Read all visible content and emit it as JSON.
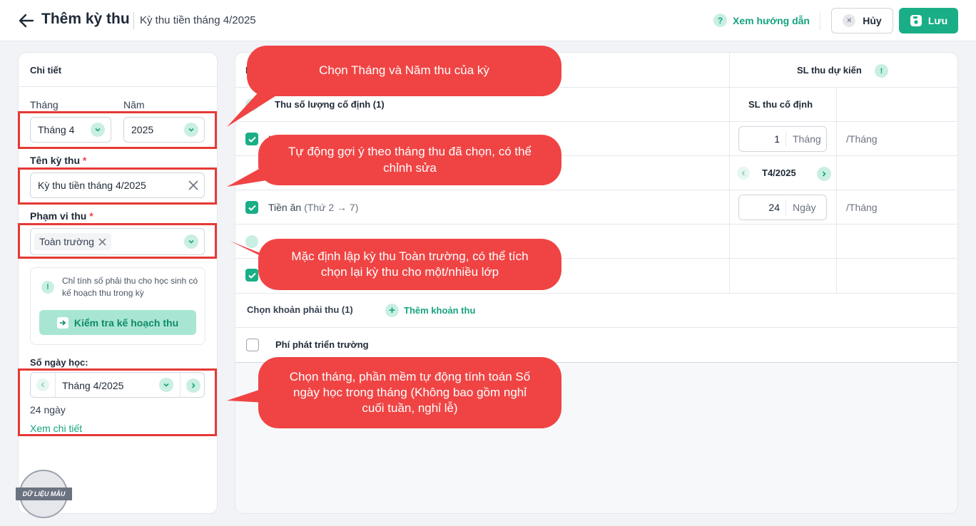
{
  "header": {
    "title": "Thêm kỳ thu",
    "subtitle": "Kỳ thu tiền tháng 4/2025",
    "guide": "Xem hướng dẫn",
    "cancel": "Hủy",
    "save": "Lưu"
  },
  "left": {
    "section": "Chi tiết",
    "month_label": "Tháng",
    "month_value": "Tháng 4",
    "year_label": "Năm",
    "year_value": "2025",
    "name_label": "Tên kỳ thu",
    "req": "*",
    "name_value": "Kỳ thu tiền tháng 4/2025",
    "scope_label": "Phạm vi thu",
    "scope_tag": "Toàn trường",
    "note": "Chỉ tính số phải thu cho học sinh có kế hoạch thu trong kỳ",
    "check_button": "Kiểm tra kế hoạch thu",
    "days_label": "Số ngày học:",
    "days_month": "Tháng 4/2025",
    "days_value": "24 ngày",
    "detail_link": "Xem chi tiết"
  },
  "right": {
    "col_head_left": "K",
    "col_head_right": "SL thu dự kiến",
    "group_fixed": "Thu số lượng cố định (1)",
    "col_fixed": "SL thu cố định",
    "row1_left": "H",
    "row1_value": "1",
    "row1_unit": "Tháng",
    "row1_per": "/Tháng",
    "month_nav": "T4/2025",
    "row2_name": "Tiền ăn",
    "row2_detail": "(Thứ 2 → 7)",
    "row2_value": "24",
    "row2_unit": "Ngày",
    "row2_per": "/Tháng",
    "optional_label": "Chọn khoản phải thu (1)",
    "add_label": "Thêm khoản thu",
    "fee": "Phí phát triển trường"
  },
  "callouts": {
    "c1": "Chọn Tháng và Năm thu của kỳ",
    "c2": "Tự động gợi ý theo tháng thu đã chọn, có thể chỉnh sửa",
    "c3": "Mặc định lập kỳ thu Toàn trường, có thể tích chọn lại kỳ thu cho một/nhiều lớp",
    "c4": "Chọn tháng, phần mềm tự động tính toán Số ngày học trong tháng (Không bao gồm nghỉ cuối tuần, nghỉ lễ)"
  },
  "stamp": "DỮ LIỆU MẪU",
  "colors": {
    "accent": "#1aae86",
    "callout": "#f04444",
    "box": "#e53935"
  }
}
